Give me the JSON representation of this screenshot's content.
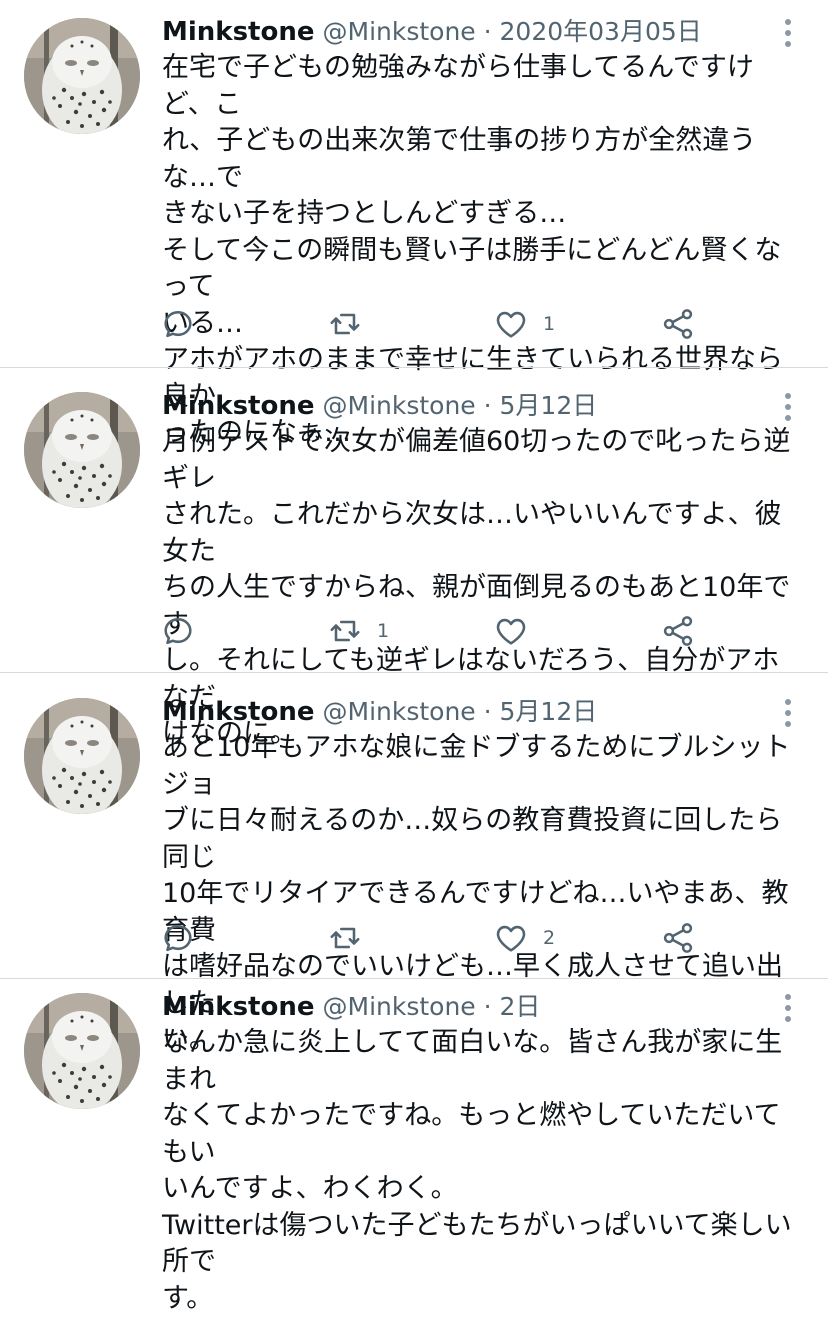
{
  "tweets": [
    {
      "name": "Minkstone",
      "handle": "@Minkstone · 2020年03月05日",
      "text": "在宅で子どもの勉強みながら仕事してるんですけど、こ\nれ、子どもの出来次第で仕事の捗り方が全然違うな…で\nきない子を持つとしんどすぎる…\nそして今この瞬間も賢い子は勝手にどんどん賢くなって\nいる…\nアホがアホのままで幸せに生きていられる世界なら良か\nったのになぁ…",
      "reply_count": "",
      "retweet_count": "",
      "like_count": "1"
    },
    {
      "name": "Minkstone",
      "handle": "@Minkstone · 5月12日",
      "text": "月例テストで次女が偏差値60切ったので叱ったら逆ギレ\nされた。これだから次女は…いやいいんですよ、彼女た\nちの人生ですからね、親が面倒見るのもあと10年です\nし。それにしても逆ギレはないだろう、自分がアホなだ\nけなのに。",
      "reply_count": "",
      "retweet_count": "1",
      "like_count": ""
    },
    {
      "name": "Minkstone",
      "handle": "@Minkstone · 5月12日",
      "text": "あと10年もアホな娘に金ドブするためにブルシットジョ\nブに日々耐えるのか…奴らの教育費投資に回したら同じ\n10年でリタイアできるんですけどね…いやまあ、教育費\nは嗜好品なのでいいけども…早く成人させて追い出した\nい。",
      "reply_count": "",
      "retweet_count": "",
      "like_count": "2"
    },
    {
      "name": "Minkstone",
      "handle": "@Minkstone · 2日",
      "text": "なんか急に炎上してて面白いな。皆さん我が家に生まれ\nなくてよかったですね。もっと燃やしていただいてもい\nいんですよ、わくわく。\nTwitterは傷ついた子どもたちがいっぱいいて楽しい所で\nす。",
      "reply_count": "",
      "retweet_count": "",
      "like_count": ""
    }
  ],
  "icons": {
    "reply": "reply-icon",
    "retweet": "retweet-icon",
    "like": "like-icon",
    "share": "share-icon",
    "more": "more-icon"
  },
  "colors": {
    "text": "#0f1419",
    "secondary": "#536471",
    "icon": "#536471",
    "divider": "#d6dadd"
  }
}
